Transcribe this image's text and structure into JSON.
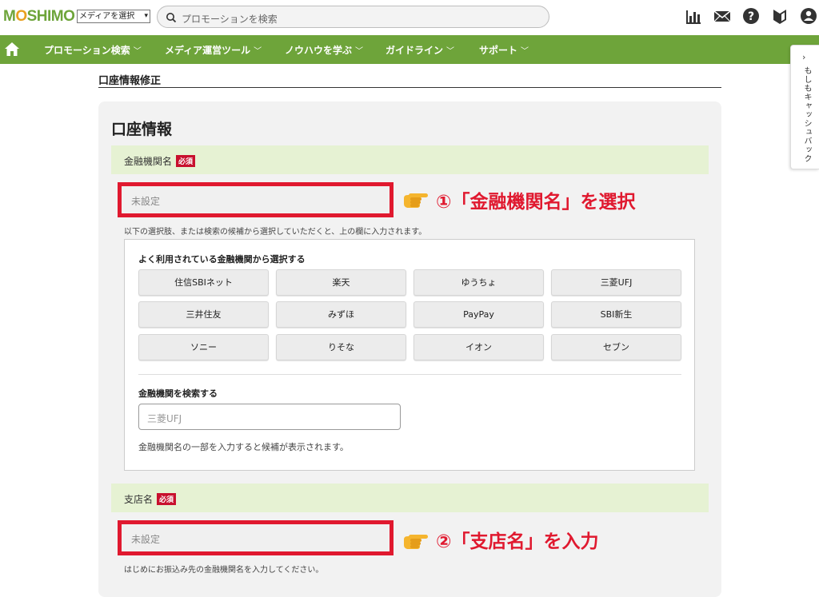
{
  "header": {
    "logo_parts": [
      "M",
      "O",
      "SHIMO"
    ],
    "media_select": "メディアを選択",
    "search_placeholder": "プロモーションを検索",
    "icons": [
      "report-icon",
      "mail-icon",
      "help-icon",
      "beginner-icon",
      "account-icon"
    ]
  },
  "nav": {
    "items": [
      "プロモーション検索",
      "メディア運営ツール",
      "ノウハウを学ぶ",
      "ガイドライン",
      "サポート"
    ]
  },
  "side_tab": {
    "label": "もしもキャッシュバック"
  },
  "page": {
    "title": "口座情報修正",
    "card_title": "口座情報"
  },
  "bank_section": {
    "label": "金融機関名",
    "required": "必須",
    "value": "未設定",
    "hint": "以下の選択肢、または検索の候補から選択していただくと、上の欄に入力されます。",
    "frequent_heading": "よく利用されている金融機関から選択する",
    "frequent_banks": [
      "住信SBIネット",
      "楽天",
      "ゆうちょ",
      "三菱UFJ",
      "三井住友",
      "みずほ",
      "PayPay",
      "SBI新生",
      "ソニー",
      "りそな",
      "イオン",
      "セブン"
    ],
    "search_heading": "金融機関を検索する",
    "search_placeholder": "三菱UFJ",
    "search_note": "金融機関名の一部を入力すると候補が表示されます。"
  },
  "branch_section": {
    "label": "支店名",
    "required": "必須",
    "value": "未設定",
    "hint": "はじめにお振込み先の金融機関名を入力してください。"
  },
  "annotations": {
    "step1": "①「金融機関名」を選択",
    "step2": "②「支店名」を入力"
  },
  "colors": {
    "brand_green": "#6ea43a",
    "section_green": "#e6f2d3",
    "annotation_red": "#e0192f",
    "badge_red": "#c8102e"
  }
}
